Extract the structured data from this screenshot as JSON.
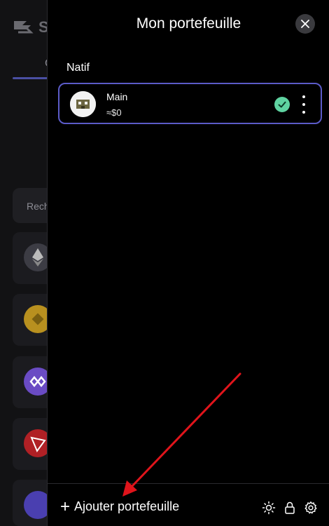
{
  "background": {
    "logo_text": "S",
    "tab_label": "C",
    "search_placeholder": "Rech",
    "token_icons": [
      "ethereum-icon",
      "bnb-icon",
      "polygon-icon",
      "tron-icon",
      "app-logo-icon"
    ],
    "token_colors": [
      "#3c3c44",
      "#b8901f",
      "#6a4bc4",
      "#b02025",
      "#4a3fb0"
    ]
  },
  "panel": {
    "title": "Mon portefeuille",
    "section_label": "Natif",
    "wallet": {
      "name": "Main",
      "balance": "≈$0",
      "status": "selected"
    },
    "footer": {
      "add_wallet_label": "Ajouter portefeuille"
    }
  },
  "colors": {
    "accent_border": "#5b5bc8",
    "check_green": "#5fd3a1",
    "annotation_red": "#e0141b"
  }
}
